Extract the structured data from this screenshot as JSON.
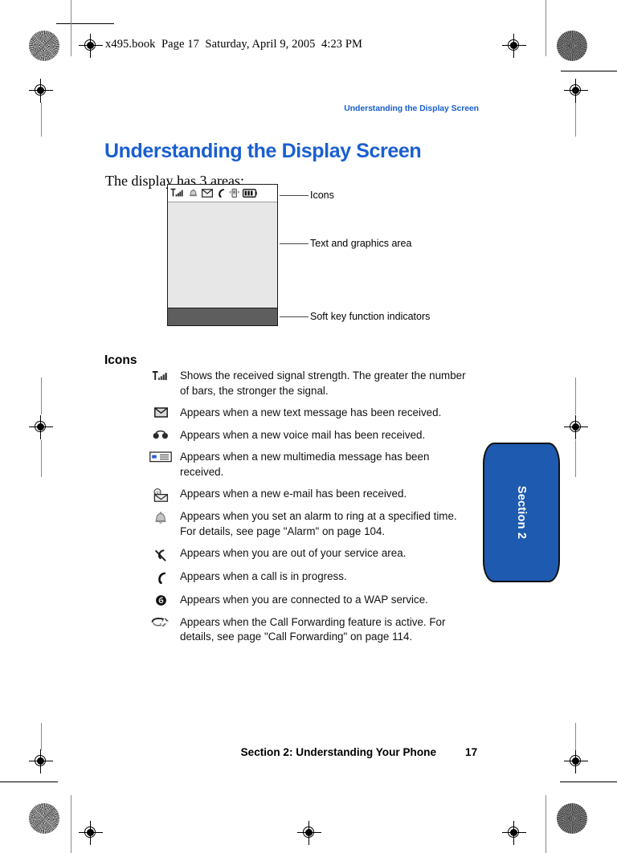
{
  "print_marks": {
    "file_header": "x495.book  Page 17  Saturday, April 9, 2005  4:23 PM"
  },
  "header": {
    "running_head": "Understanding the Display Screen"
  },
  "main": {
    "title": "Understanding the Display Screen",
    "intro": "The display has 3 areas:",
    "figure": {
      "callouts": [
        "Icons",
        "Text and graphics area",
        "Soft key function indicators"
      ],
      "statusbar_icons": [
        "signal-strength-icon",
        "alarm-icon",
        "text-message-icon",
        "call-in-progress-icon",
        "vibrate-icon",
        "battery-icon"
      ]
    },
    "icons_section": {
      "heading": "Icons",
      "rows": [
        {
          "icon": "signal-strength-icon",
          "description": "Shows the received signal strength. The greater the number of bars, the stronger the signal."
        },
        {
          "icon": "text-message-icon",
          "description": "Appears when a new text message has been received."
        },
        {
          "icon": "voice-mail-icon",
          "description": "Appears when a new voice mail has been received."
        },
        {
          "icon": "multimedia-message-icon",
          "description": "Appears when a new multimedia message has been received."
        },
        {
          "icon": "email-icon",
          "description": "Appears when a new e-mail has been received."
        },
        {
          "icon": "alarm-icon",
          "description": "Appears when you set an alarm to ring at a specified time. For details, see page \"Alarm\" on page 104."
        },
        {
          "icon": "out-of-service-area-icon",
          "description": "Appears when you are out of your service area."
        },
        {
          "icon": "call-in-progress-icon",
          "description": "Appears when a call is in progress."
        },
        {
          "icon": "wap-service-icon",
          "description": "Appears when you are connected to a WAP service."
        },
        {
          "icon": "call-forwarding-icon",
          "description": "Appears when the Call Forwarding feature is active. For details, see page \"Call Forwarding\" on page 114."
        }
      ]
    }
  },
  "side_tab": {
    "label": "Section 2"
  },
  "footer": {
    "section_text": "Section 2: Understanding Your Phone",
    "page_number": "17"
  },
  "colors": {
    "heading_blue": "#1a5fd0",
    "tab_blue": "#1e5bb0",
    "screen_area": "#e7e7e7",
    "softkey_bar": "#5e5e5e"
  }
}
